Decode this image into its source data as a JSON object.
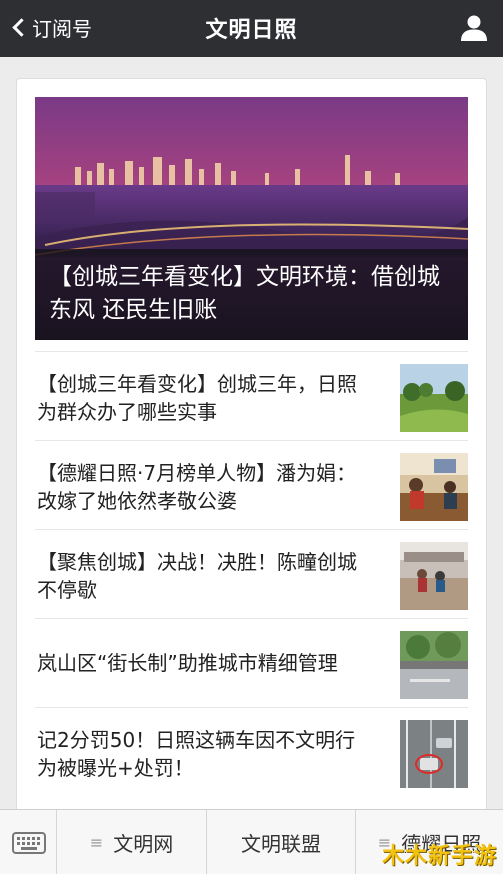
{
  "navbar": {
    "back_label": "订阅号",
    "title": "文明日照"
  },
  "hero": {
    "caption": "【创城三年看变化】文明环境：借创城东风 还民生旧账"
  },
  "articles": [
    {
      "title": "【创城三年看变化】创城三年，日照为群众办了哪些实事",
      "thumb": "park-lawn"
    },
    {
      "title": "【德耀日照·7月榜单人物】潘为娟：改嫁了她依然孝敬公婆",
      "thumb": "home-interior"
    },
    {
      "title": "【聚焦创城】决战！决胜！陈疃创城不停歇",
      "thumb": "village-square"
    },
    {
      "title": "岚山区“街长制”助推城市精细管理",
      "thumb": "street-trees"
    },
    {
      "title": "记2分罚50！日照这辆车因不文明行为被曝光+处罚！",
      "thumb": "traffic-camera"
    }
  ],
  "bottom_menu": {
    "items": [
      {
        "label": "文明网"
      },
      {
        "label": "文明联盟"
      },
      {
        "label": "德耀日照"
      }
    ]
  },
  "watermark": "木木新手游",
  "icons": {
    "back": "chevron-left-icon",
    "user": "user-icon",
    "keyboard": "keyboard-icon",
    "menu": "hamburger-icon"
  }
}
